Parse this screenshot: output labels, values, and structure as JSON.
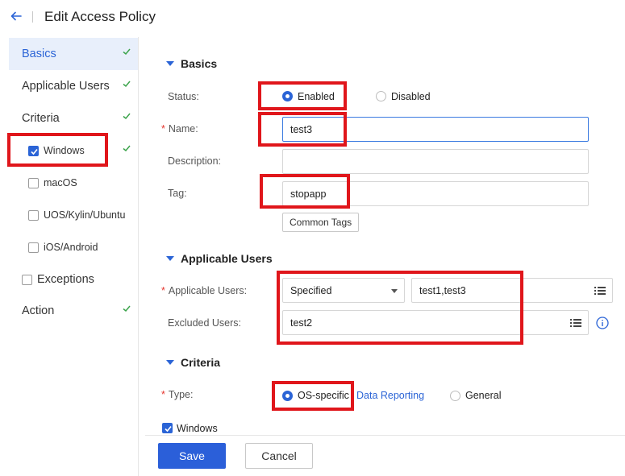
{
  "header": {
    "title": "Edit Access Policy"
  },
  "sidebar": {
    "items": [
      {
        "label": "Basics"
      },
      {
        "label": "Applicable Users"
      },
      {
        "label": "Criteria"
      },
      {
        "label": "Windows"
      },
      {
        "label": "macOS"
      },
      {
        "label": "UOS/Kylin/Ubuntu"
      },
      {
        "label": "iOS/Android"
      },
      {
        "label": "Exceptions"
      },
      {
        "label": "Action"
      }
    ]
  },
  "basics": {
    "title": "Basics",
    "status_label": "Status:",
    "status_enabled": "Enabled",
    "status_disabled": "Disabled",
    "status_selected": "Enabled",
    "name_label": "Name:",
    "name_value": "test3",
    "description_label": "Description:",
    "description_value": "",
    "tag_label": "Tag:",
    "tag_value": "stopapp",
    "common_tags_button": "Common Tags"
  },
  "applicable_users": {
    "title": "Applicable Users",
    "applicable_label": "Applicable Users:",
    "scope_select": "Specified",
    "users_value": "test1,test3",
    "excluded_label": "Excluded Users:",
    "excluded_value": "test2"
  },
  "criteria": {
    "title": "Criteria",
    "type_label": "Type:",
    "type_os_specific": "OS-specific",
    "data_reporting_link": "Data Reporting",
    "type_general": "General",
    "type_selected": "OS-specific",
    "windows_checkbox": "Windows"
  },
  "footer": {
    "save_label": "Save",
    "cancel_label": "Cancel"
  },
  "colors": {
    "accent": "#2b64d6",
    "highlight": "#e0161b",
    "success": "#3aa34a"
  },
  "icons": [
    "back-arrow-icon",
    "checkmark-icon",
    "caret-down-icon",
    "list-icon",
    "info-icon"
  ]
}
